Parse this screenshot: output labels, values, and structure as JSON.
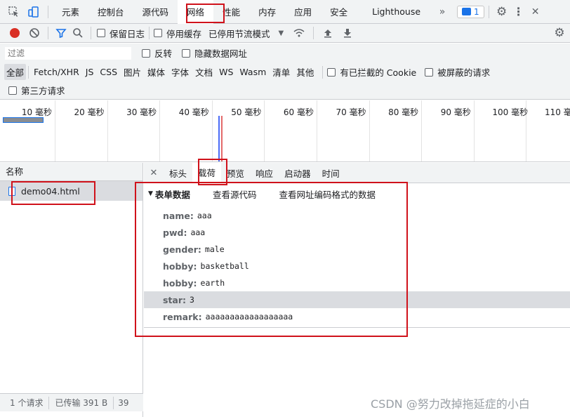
{
  "main_tabs": [
    "元素",
    "控制台",
    "源代码",
    "网络",
    "性能",
    "内存",
    "应用",
    "安全",
    "Lighthouse"
  ],
  "issues_count": "1",
  "toolbar": {
    "preserve_log": "保留日志",
    "disable_cache": "停用缓存",
    "throttling": "已停用节流模式"
  },
  "filter": {
    "placeholder": "过滤",
    "invert": "反转",
    "hide_data_urls": "隐藏数据网址"
  },
  "type_filters": [
    "全部",
    "Fetch/XHR",
    "JS",
    "CSS",
    "图片",
    "媒体",
    "字体",
    "文档",
    "WS",
    "Wasm",
    "清单",
    "其他"
  ],
  "blocked_cookies": "有已拦截的 Cookie",
  "blocked_requests": "被屏蔽的请求",
  "third_party": "第三方请求",
  "timeline_ticks": [
    "10 毫秒",
    "20 毫秒",
    "30 毫秒",
    "40 毫秒",
    "50 毫秒",
    "60 毫秒",
    "70 毫秒",
    "80 毫秒",
    "90 毫秒",
    "100 毫秒",
    "110 毫秒"
  ],
  "request_list": {
    "header": "名称",
    "items": [
      "demo04.html"
    ]
  },
  "detail_tabs": [
    "标头",
    "载荷",
    "预览",
    "响应",
    "启动器",
    "时间"
  ],
  "payload": {
    "section_title": "表单数据",
    "view_source": "查看源代码",
    "view_url_encoded": "查看网址编码格式的数据",
    "fields": [
      {
        "key": "name:",
        "value": "aaa"
      },
      {
        "key": "pwd:",
        "value": "aaa"
      },
      {
        "key": "gender:",
        "value": "male"
      },
      {
        "key": "hobby:",
        "value": "basketball"
      },
      {
        "key": "hobby:",
        "value": "earth"
      },
      {
        "key": "star:",
        "value": "3"
      },
      {
        "key": "remark:",
        "value": "aaaaaaaaaaaaaaaaaa"
      }
    ]
  },
  "status_bar": {
    "requests": "1 个请求",
    "transferred": "已传输 391 B",
    "more": "39"
  },
  "watermark": "CSDN @努力改掉拖延症的小白",
  "colors": {
    "accent": "#1a73e8",
    "record_red": "#d93025",
    "highlight_box": "#d0121b",
    "selected_row": "#dadce0"
  }
}
